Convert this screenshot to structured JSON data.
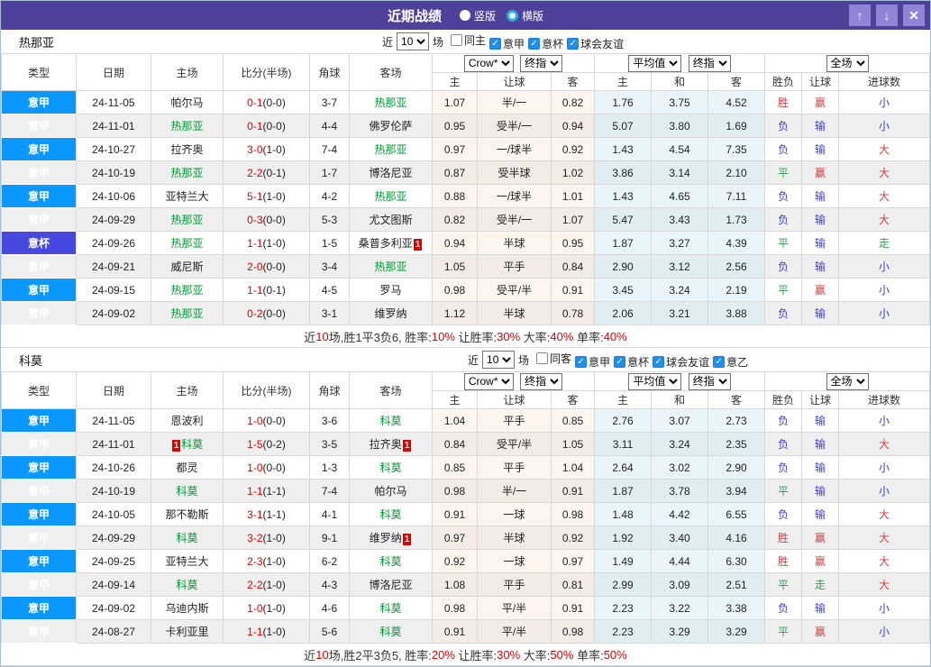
{
  "titlebar": {
    "title": "近期战绩",
    "radio_vertical": "竖版",
    "radio_horizontal": "横版",
    "selected_layout": "横版"
  },
  "icons": {
    "up_arrow": "↑",
    "down_arrow": "↓",
    "close": "✕",
    "check": "✓"
  },
  "colors": {
    "titlebar_bg": "#4e4199",
    "button_bg": "#9184d6",
    "league_blue": "#0a98ff",
    "cup_purple": "#4848e0",
    "team_highlight": "#009933",
    "score_red": "#e00000",
    "win_red": "#d33e3e",
    "draw_green": "#2e9e4f",
    "lose_blue": "#3b3bd6"
  },
  "table_headers": {
    "cols": [
      "类型",
      "日期",
      "主场",
      "比分(半场)",
      "角球",
      "客场"
    ],
    "dd": [
      "Crow*",
      "终指",
      "平均值",
      "终指",
      "全场"
    ],
    "sub": [
      "主",
      "让球",
      "客",
      "主",
      "和",
      "客",
      "胜负",
      "让球",
      "进球数"
    ]
  },
  "sections": [
    {
      "team": "热那亚",
      "filters": {
        "prefix": "近",
        "count": "10",
        "suffix": "场",
        "checkboxes": [
          {
            "label": "同主",
            "checked": false
          },
          {
            "label": "意甲",
            "checked": true
          },
          {
            "label": "意杯",
            "checked": true
          },
          {
            "label": "球会友谊",
            "checked": true
          }
        ]
      },
      "rows": [
        {
          "type": "意甲",
          "date": "24-11-05",
          "home": "帕尔马",
          "away": "热那亚",
          "away_hl": true,
          "score": "0-1",
          "half": "(0-0)",
          "corner": "3-7",
          "crow": [
            "1.07",
            "半/一",
            "0.82"
          ],
          "avg": [
            "1.76",
            "3.75",
            "4.52"
          ],
          "res": [
            "胜",
            "赢",
            "小"
          ]
        },
        {
          "type": "意甲",
          "date": "24-11-01",
          "home": "热那亚",
          "home_hl": true,
          "away": "佛罗伦萨",
          "score": "0-1",
          "half": "(0-0)",
          "corner": "4-4",
          "crow": [
            "0.95",
            "受半/一",
            "0.94"
          ],
          "avg": [
            "5.07",
            "3.80",
            "1.69"
          ],
          "res": [
            "负",
            "输",
            "小"
          ]
        },
        {
          "type": "意甲",
          "date": "24-10-27",
          "home": "拉齐奥",
          "away": "热那亚",
          "away_hl": true,
          "score": "3-0",
          "half": "(1-0)",
          "corner": "7-4",
          "crow": [
            "0.97",
            "一/球半",
            "0.92"
          ],
          "avg": [
            "1.43",
            "4.54",
            "7.35"
          ],
          "res": [
            "负",
            "输",
            "大"
          ]
        },
        {
          "type": "意甲",
          "date": "24-10-19",
          "home": "热那亚",
          "home_hl": true,
          "away": "博洛尼亚",
          "score": "2-2",
          "half": "(0-1)",
          "corner": "1-7",
          "crow": [
            "0.87",
            "受半球",
            "1.02"
          ],
          "avg": [
            "3.86",
            "3.14",
            "2.10"
          ],
          "res": [
            "平",
            "赢",
            "大"
          ]
        },
        {
          "type": "意甲",
          "date": "24-10-06",
          "home": "亚特兰大",
          "away": "热那亚",
          "away_hl": true,
          "score": "5-1",
          "half": "(1-0)",
          "corner": "4-2",
          "crow": [
            "0.88",
            "一/球半",
            "1.01"
          ],
          "avg": [
            "1.43",
            "4.65",
            "7.11"
          ],
          "res": [
            "负",
            "输",
            "大"
          ]
        },
        {
          "type": "意甲",
          "date": "24-09-29",
          "home": "热那亚",
          "home_hl": true,
          "away": "尤文图斯",
          "score": "0-3",
          "half": "(0-0)",
          "corner": "5-3",
          "crow": [
            "0.82",
            "受半/一",
            "1.07"
          ],
          "avg": [
            "5.47",
            "3.43",
            "1.73"
          ],
          "res": [
            "负",
            "输",
            "大"
          ]
        },
        {
          "type": "意杯",
          "cup": true,
          "date": "24-09-26",
          "home": "热那亚",
          "home_hl": true,
          "away": "桑普多利亚",
          "away_card": "1",
          "score": "1-1",
          "half": "(1-0)",
          "corner": "1-5",
          "crow": [
            "0.94",
            "半球",
            "0.95"
          ],
          "avg": [
            "1.87",
            "3.27",
            "4.39"
          ],
          "res": [
            "平",
            "输",
            "走"
          ]
        },
        {
          "type": "意甲",
          "date": "24-09-21",
          "home": "威尼斯",
          "away": "热那亚",
          "away_hl": true,
          "score": "2-0",
          "half": "(0-0)",
          "corner": "3-4",
          "crow": [
            "1.05",
            "平手",
            "0.84"
          ],
          "avg": [
            "2.90",
            "3.12",
            "2.56"
          ],
          "res": [
            "负",
            "输",
            "小"
          ]
        },
        {
          "type": "意甲",
          "date": "24-09-15",
          "home": "热那亚",
          "home_hl": true,
          "away": "罗马",
          "score": "1-1",
          "half": "(0-1)",
          "corner": "4-5",
          "crow": [
            "0.98",
            "受平/半",
            "0.91"
          ],
          "avg": [
            "3.45",
            "3.24",
            "2.19"
          ],
          "res": [
            "平",
            "赢",
            "小"
          ]
        },
        {
          "type": "意甲",
          "date": "24-09-02",
          "home": "热那亚",
          "home_hl": true,
          "away": "维罗纳",
          "score": "0-2",
          "half": "(0-0)",
          "corner": "3-1",
          "crow": [
            "1.12",
            "半球",
            "0.78"
          ],
          "avg": [
            "2.06",
            "3.21",
            "3.88"
          ],
          "res": [
            "负",
            "输",
            "小"
          ]
        }
      ],
      "summary": [
        {
          "t": "近"
        },
        {
          "t": "10",
          "red": true
        },
        {
          "t": "场,胜1平3负6, 胜率:"
        },
        {
          "t": "10%",
          "red": true
        },
        {
          "t": " 让胜率:"
        },
        {
          "t": "30%",
          "red": true
        },
        {
          "t": " 大率:"
        },
        {
          "t": "40%",
          "red": true
        },
        {
          "t": " 单率:"
        },
        {
          "t": "40%",
          "red": true
        }
      ]
    },
    {
      "team": "科莫",
      "filters": {
        "prefix": "近",
        "count": "10",
        "suffix": "场",
        "checkboxes": [
          {
            "label": "同客",
            "checked": false
          },
          {
            "label": "意甲",
            "checked": true
          },
          {
            "label": "意杯",
            "checked": true
          },
          {
            "label": "球会友谊",
            "checked": true
          },
          {
            "label": "意乙",
            "checked": true
          }
        ]
      },
      "rows": [
        {
          "type": "意甲",
          "date": "24-11-05",
          "home": "恩波利",
          "away": "科莫",
          "away_hl": true,
          "score": "1-0",
          "half": "(0-0)",
          "corner": "3-6",
          "crow": [
            "1.04",
            "平手",
            "0.85"
          ],
          "avg": [
            "2.76",
            "3.07",
            "2.73"
          ],
          "res": [
            "负",
            "输",
            "小"
          ]
        },
        {
          "type": "意甲",
          "date": "24-11-01",
          "home": "科莫",
          "home_hl": true,
          "home_card": "1",
          "home_card_before": true,
          "away": "拉齐奥",
          "away_card": "1",
          "score": "1-5",
          "half": "(0-2)",
          "corner": "3-5",
          "crow": [
            "0.84",
            "受平/半",
            "1.05"
          ],
          "avg": [
            "3.11",
            "3.24",
            "2.35"
          ],
          "res": [
            "负",
            "输",
            "大"
          ]
        },
        {
          "type": "意甲",
          "date": "24-10-26",
          "home": "都灵",
          "away": "科莫",
          "away_hl": true,
          "score": "1-0",
          "half": "(0-0)",
          "corner": "1-3",
          "crow": [
            "0.85",
            "平手",
            "1.04"
          ],
          "avg": [
            "2.64",
            "3.02",
            "2.90"
          ],
          "res": [
            "负",
            "输",
            "小"
          ]
        },
        {
          "type": "意甲",
          "date": "24-10-19",
          "home": "科莫",
          "home_hl": true,
          "away": "帕尔马",
          "score": "1-1",
          "half": "(1-1)",
          "corner": "7-4",
          "crow": [
            "0.98",
            "半/一",
            "0.91"
          ],
          "avg": [
            "1.87",
            "3.78",
            "3.94"
          ],
          "res": [
            "平",
            "输",
            "小"
          ]
        },
        {
          "type": "意甲",
          "date": "24-10-05",
          "home": "那不勒斯",
          "away": "科莫",
          "away_hl": true,
          "score": "3-1",
          "half": "(1-1)",
          "corner": "4-1",
          "crow": [
            "0.91",
            "一球",
            "0.98"
          ],
          "avg": [
            "1.48",
            "4.42",
            "6.55"
          ],
          "res": [
            "负",
            "输",
            "大"
          ]
        },
        {
          "type": "意甲",
          "date": "24-09-29",
          "home": "科莫",
          "home_hl": true,
          "away": "维罗纳",
          "away_card": "1",
          "score": "3-2",
          "half": "(1-0)",
          "corner": "9-1",
          "crow": [
            "0.97",
            "半球",
            "0.92"
          ],
          "avg": [
            "1.92",
            "3.40",
            "4.16"
          ],
          "res": [
            "胜",
            "赢",
            "大"
          ]
        },
        {
          "type": "意甲",
          "date": "24-09-25",
          "home": "亚特兰大",
          "away": "科莫",
          "away_hl": true,
          "score": "2-3",
          "half": "(1-0)",
          "corner": "6-2",
          "crow": [
            "0.92",
            "一球",
            "0.97"
          ],
          "avg": [
            "1.49",
            "4.44",
            "6.30"
          ],
          "res": [
            "胜",
            "赢",
            "大"
          ]
        },
        {
          "type": "意甲",
          "date": "24-09-14",
          "home": "科莫",
          "home_hl": true,
          "away": "博洛尼亚",
          "score": "2-2",
          "half": "(1-0)",
          "corner": "4-3",
          "crow": [
            "1.08",
            "平手",
            "0.81"
          ],
          "avg": [
            "2.99",
            "3.09",
            "2.51"
          ],
          "res": [
            "平",
            "走",
            "大"
          ]
        },
        {
          "type": "意甲",
          "date": "24-09-02",
          "home": "乌迪内斯",
          "away": "科莫",
          "away_hl": true,
          "score": "1-0",
          "half": "(1-0)",
          "corner": "4-6",
          "crow": [
            "0.98",
            "平/半",
            "0.91"
          ],
          "avg": [
            "2.23",
            "3.22",
            "3.38"
          ],
          "res": [
            "负",
            "输",
            "小"
          ]
        },
        {
          "type": "意甲",
          "date": "24-08-27",
          "home": "卡利亚里",
          "away": "科莫",
          "away_hl": true,
          "score": "1-1",
          "half": "(1-0)",
          "corner": "5-6",
          "crow": [
            "0.91",
            "平/半",
            "0.98"
          ],
          "avg": [
            "2.23",
            "3.29",
            "3.29"
          ],
          "res": [
            "平",
            "赢",
            "小"
          ]
        }
      ],
      "summary": [
        {
          "t": "近"
        },
        {
          "t": "10",
          "red": true
        },
        {
          "t": "场,胜2平3负5, 胜率:"
        },
        {
          "t": "20%",
          "red": true
        },
        {
          "t": " 让胜率:"
        },
        {
          "t": "30%",
          "red": true
        },
        {
          "t": " 大率:"
        },
        {
          "t": "50%",
          "red": true
        },
        {
          "t": " 单率:"
        },
        {
          "t": "50%",
          "red": true
        }
      ]
    }
  ]
}
